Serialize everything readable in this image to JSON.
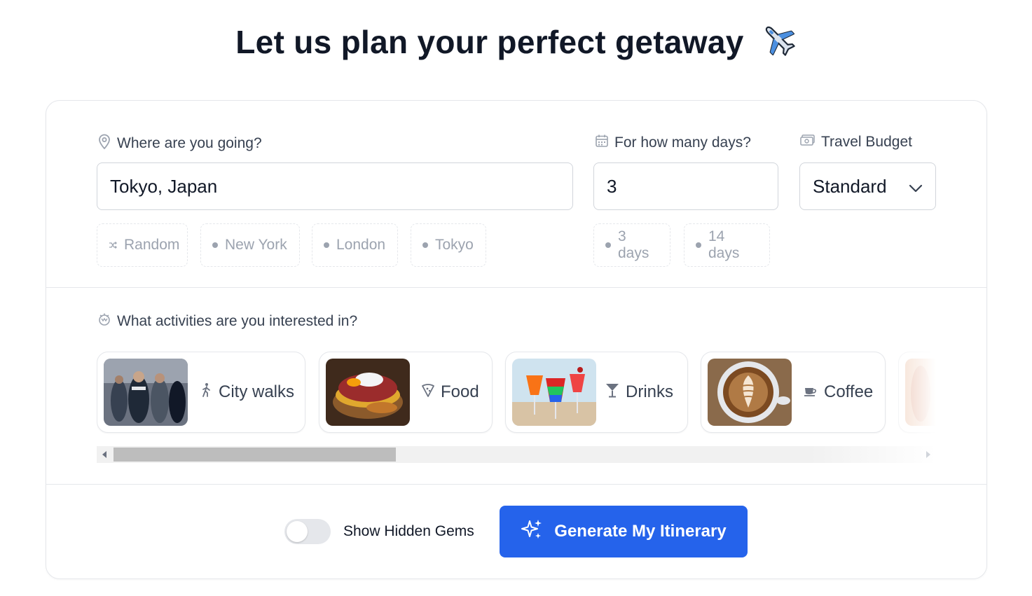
{
  "header": {
    "title": "Let us plan your perfect getaway",
    "title_icon": "airplane-icon"
  },
  "destination": {
    "label": "Where are you going?",
    "value": "Tokyo, Japan",
    "suggestions": [
      {
        "label": "Random",
        "icon": "shuffle-icon"
      },
      {
        "label": "New York",
        "icon": "dot-icon"
      },
      {
        "label": "London",
        "icon": "dot-icon"
      },
      {
        "label": "Tokyo",
        "icon": "dot-icon"
      }
    ]
  },
  "days": {
    "label": "For how many days?",
    "value": "3",
    "suggestions": [
      {
        "label": "3 days"
      },
      {
        "label": "14 days"
      }
    ]
  },
  "budget": {
    "label": "Travel Budget",
    "value": "Standard"
  },
  "activities": {
    "label": "What activities are you interested in?",
    "items": [
      {
        "label": "City walks",
        "icon": "walking-person-icon"
      },
      {
        "label": "Food",
        "icon": "pizza-icon"
      },
      {
        "label": "Drinks",
        "icon": "cocktail-icon"
      },
      {
        "label": "Coffee",
        "icon": "coffee-cup-icon"
      }
    ]
  },
  "footer": {
    "hidden_gems_label": "Show Hidden Gems",
    "hidden_gems_enabled": false,
    "generate_label": "Generate My Itinerary"
  },
  "colors": {
    "primary": "#2563eb",
    "border": "#e5e7eb",
    "muted_text": "#9ca3af"
  }
}
